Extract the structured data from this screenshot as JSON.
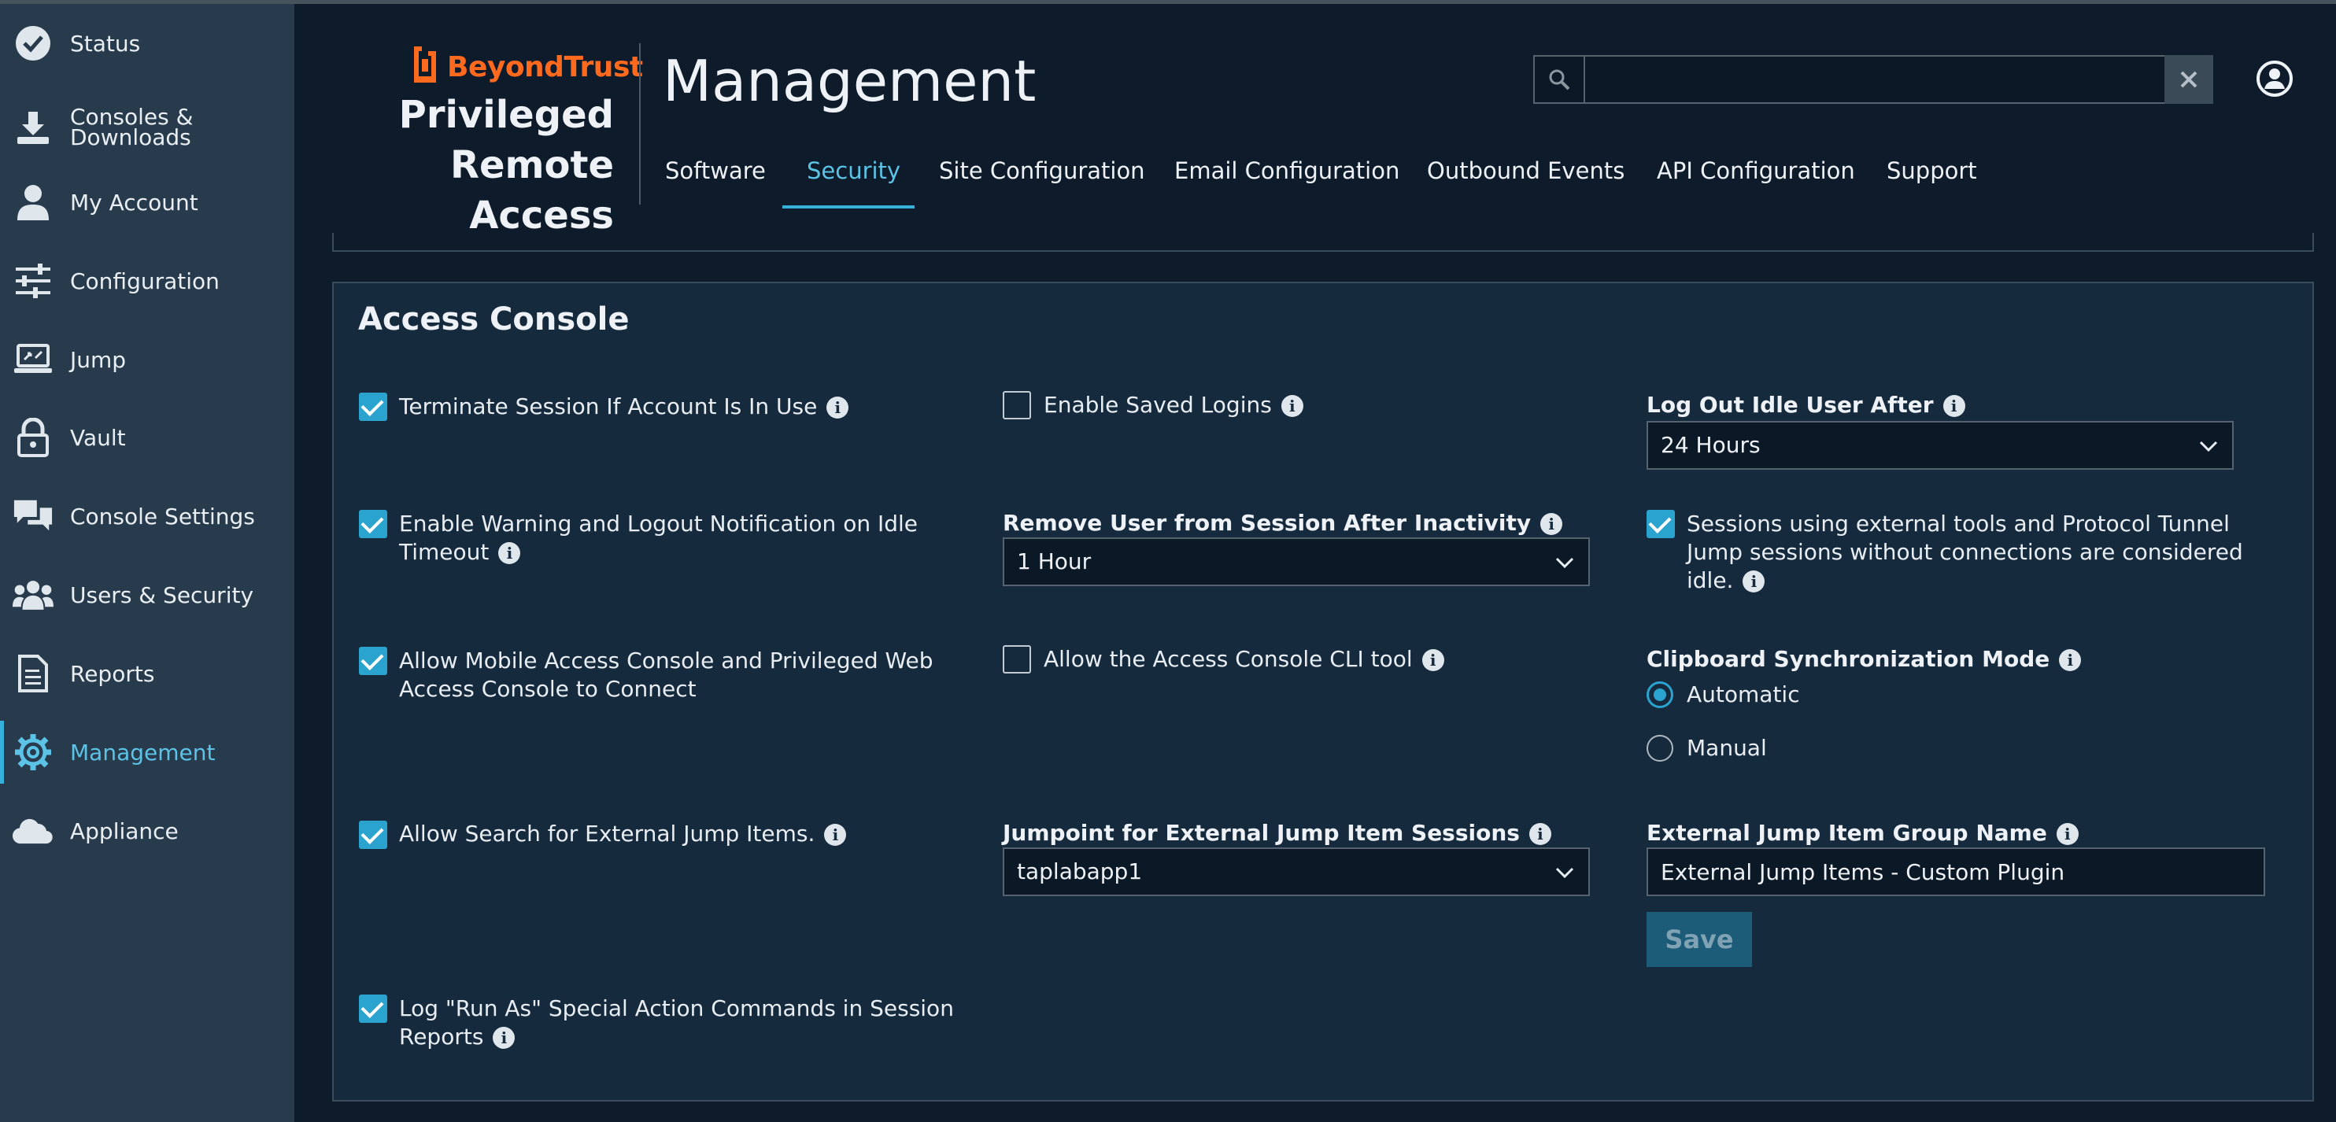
{
  "sidebar": {
    "items": [
      {
        "label": "Status",
        "icon": "check-circle-icon"
      },
      {
        "label": "Consoles &\nDownloads",
        "icon": "download-icon"
      },
      {
        "label": "My Account",
        "icon": "user-icon"
      },
      {
        "label": "Configuration",
        "icon": "sliders-icon"
      },
      {
        "label": "Jump",
        "icon": "jump-laptop-icon"
      },
      {
        "label": "Vault",
        "icon": "lock-icon"
      },
      {
        "label": "Console Settings",
        "icon": "chat-bubbles-icon"
      },
      {
        "label": "Users & Security",
        "icon": "users-icon"
      },
      {
        "label": "Reports",
        "icon": "report-icon"
      },
      {
        "label": "Management",
        "icon": "gear-icon",
        "active": true
      },
      {
        "label": "Appliance",
        "icon": "cloud-icon"
      }
    ]
  },
  "header": {
    "brand": "BeyondTrust",
    "product": "Privileged\nRemote Access",
    "title": "Management",
    "search": {
      "value": "",
      "placeholder": ""
    },
    "tabs": [
      {
        "label": "Software"
      },
      {
        "label": "Security",
        "active": true
      },
      {
        "label": "Site Configuration"
      },
      {
        "label": "Email Configuration"
      },
      {
        "label": "Outbound Events"
      },
      {
        "label": "API Configuration"
      },
      {
        "label": "Support"
      }
    ]
  },
  "colors": {
    "accent": "#2aa3cf",
    "brand": "#ff6a1f",
    "sidebar": "#283b4d",
    "background": "#0d1b2a"
  },
  "access_console": {
    "title": "Access Console",
    "terminate_session": {
      "label": "Terminate Session If Account Is In Use",
      "checked": true
    },
    "enable_saved_logins": {
      "label": "Enable Saved Logins",
      "checked": false
    },
    "log_out_idle": {
      "label": "Log Out Idle User After",
      "value": "24 Hours"
    },
    "warning_logout": {
      "label_line1": "Enable Warning and Logout Notification on Idle",
      "label_line2": "Timeout",
      "checked": true
    },
    "remove_user": {
      "label": "Remove User from Session After Inactivity",
      "value": "1 Hour"
    },
    "external_tools_idle": {
      "label_line1": "Sessions using external tools and Protocol Tunnel",
      "label_line2": "Jump sessions without connections are considered",
      "label_line3": "idle.",
      "checked": true
    },
    "allow_mobile": {
      "label_line1": "Allow Mobile Access Console and Privileged Web",
      "label_line2": "Access Console to Connect",
      "checked": true
    },
    "allow_cli": {
      "label": "Allow the Access Console CLI tool",
      "checked": false
    },
    "clipboard_sync": {
      "label": "Clipboard Synchronization Mode",
      "options": [
        "Automatic",
        "Manual"
      ],
      "selected": "Automatic"
    },
    "allow_search_external": {
      "label": "Allow Search for External Jump Items.",
      "checked": true
    },
    "jumpoint": {
      "label": "Jumpoint for External Jump Item Sessions",
      "value": "taplabapp1"
    },
    "external_group_name": {
      "label": "External Jump Item Group Name",
      "value": "External Jump Items - Custom Plugin"
    },
    "save_label": "Save",
    "log_run_as": {
      "label_line1": "Log \"Run As\" Special Action Commands in Session",
      "label_line2": "Reports",
      "checked": true
    }
  }
}
